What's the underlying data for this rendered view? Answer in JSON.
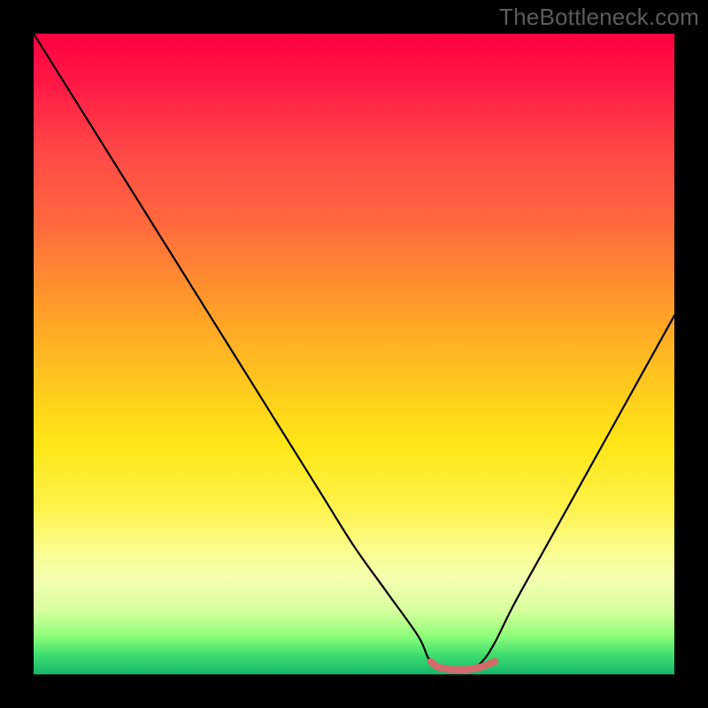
{
  "watermark": "TheBottleneck.com",
  "chart_data": {
    "type": "line",
    "title": "",
    "xlabel": "",
    "ylabel": "",
    "xlim": [
      0,
      100
    ],
    "ylim": [
      0,
      100
    ],
    "series": [
      {
        "name": "bottleneck-curve",
        "x": [
          0,
          5,
          10,
          15,
          20,
          25,
          30,
          35,
          40,
          45,
          50,
          55,
          60,
          62,
          65,
          68,
          70,
          72,
          75,
          80,
          85,
          90,
          95,
          100
        ],
        "values": [
          100,
          92,
          84,
          76,
          68,
          60,
          52,
          44,
          36,
          28,
          20,
          13,
          6,
          2.0,
          0.8,
          0.8,
          2.0,
          5,
          11,
          20,
          29,
          38,
          47,
          56
        ]
      },
      {
        "name": "optimal-range-marker",
        "x": [
          62,
          63,
          65,
          68,
          70,
          71,
          72
        ],
        "values": [
          2.0,
          1.2,
          0.8,
          0.8,
          1.2,
          1.6,
          2.0
        ]
      }
    ],
    "gradient_stops": [
      {
        "pos": 0,
        "color": "#ff0040"
      },
      {
        "pos": 18,
        "color": "#ff4747"
      },
      {
        "pos": 42,
        "color": "#ff9a2a"
      },
      {
        "pos": 64,
        "color": "#ffe617"
      },
      {
        "pos": 85,
        "color": "#f5ffb0"
      },
      {
        "pos": 97,
        "color": "#3fdd6e"
      },
      {
        "pos": 100,
        "color": "#13b56a"
      }
    ],
    "optimal_marker_color": "#d66a6a"
  }
}
